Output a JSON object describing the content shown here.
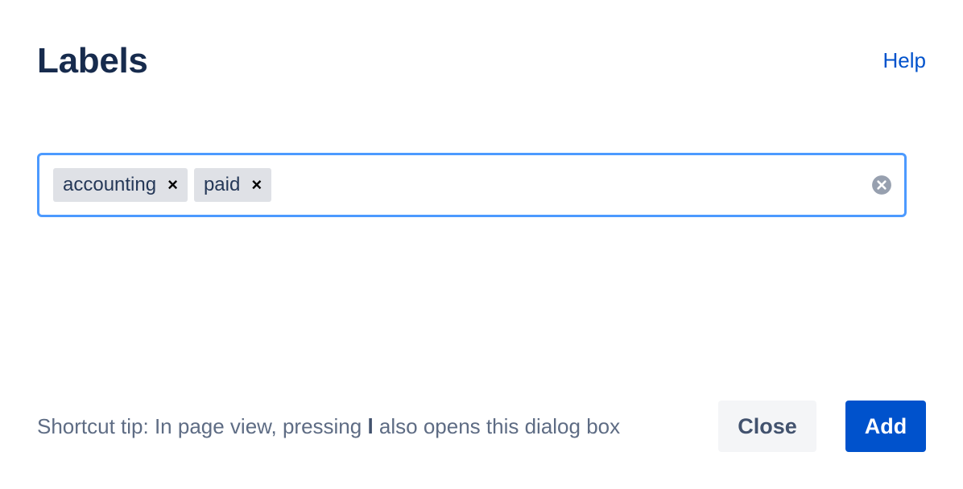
{
  "dialog": {
    "title": "Labels",
    "help_link": "Help"
  },
  "label_field": {
    "tags": [
      {
        "label": "accounting",
        "remove_glyph": "×"
      },
      {
        "label": "paid",
        "remove_glyph": "×"
      }
    ],
    "input_value": "",
    "clear_icon": "clear-circle-icon"
  },
  "footer": {
    "tip_prefix": "Shortcut tip: In page view, pressing ",
    "tip_key": "l",
    "tip_suffix": " also opens this dialog box",
    "close_label": "Close",
    "add_label": "Add"
  },
  "colors": {
    "title": "#172b4d",
    "link": "#0052cc",
    "focus_border": "#4c9aff",
    "tag_bg": "#dfe1e6",
    "primary_button": "#0052cc",
    "secondary_button": "#f4f5f7",
    "muted_text": "#5e6c84"
  }
}
